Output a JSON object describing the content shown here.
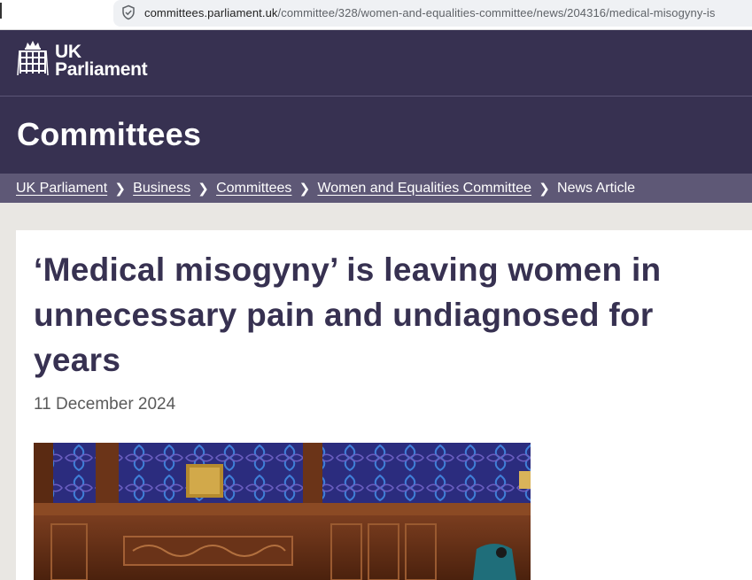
{
  "browser": {
    "url_host": "committees.parliament.uk",
    "url_path": "/committee/328/women-and-equalities-committee/news/204316/medical-misogyny-is",
    "security_icon": "shield-check-icon"
  },
  "header": {
    "logo_line1": "UK",
    "logo_line2": "Parliament",
    "logo_icon": "portcullis-icon",
    "section_title": "Committees",
    "bg_color": "#373151"
  },
  "breadcrumb": {
    "items": [
      {
        "label": "UK Parliament"
      },
      {
        "label": "Business"
      },
      {
        "label": "Committees"
      },
      {
        "label": "Women and Equalities Committee"
      }
    ],
    "current": "News Article",
    "separator_icon": "chevron-right-icon",
    "bg_color": "#5e5876"
  },
  "article": {
    "title": "‘Medical misogyny’ is leaving women in unnecessary pain and undiagnosed for years",
    "date": "11 December 2024",
    "image_icon": "committee-room-photo"
  }
}
